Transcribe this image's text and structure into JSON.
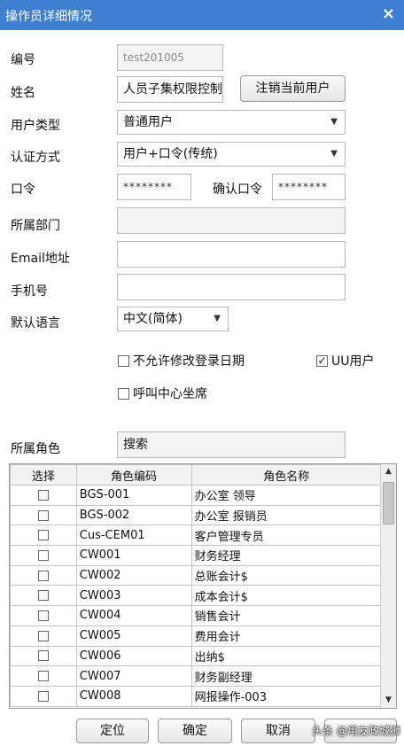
{
  "window": {
    "title": "操作员详细情况",
    "close": "×"
  },
  "form": {
    "id_label": "编号",
    "id_value": "test201005",
    "name_label": "姓名",
    "name_value": "人员子集权限控制",
    "cancel_user_button": "注销当前用户",
    "user_type_label": "用户类型",
    "user_type_value": "普通用户",
    "auth_label": "认证方式",
    "auth_value": "用户+口令(传统)",
    "password_label": "口令",
    "password_value": "********",
    "confirm_label": "确认口令",
    "confirm_value": "********",
    "dept_label": "所属部门",
    "dept_value": "",
    "email_label": "Email地址",
    "email_value": "",
    "phone_label": "手机号",
    "phone_value": "",
    "lang_label": "默认语言",
    "lang_value": "中文(简体)",
    "no_change_login_date": {
      "label": "不允许修改登录日期",
      "checked": false
    },
    "uu_user": {
      "label": "UU用户",
      "checked": true
    },
    "call_center_agent": {
      "label": "呼叫中心坐席",
      "checked": false
    },
    "role_label": "所属角色",
    "role_search_value": "搜索"
  },
  "grid": {
    "headers": [
      "选择",
      "角色编码",
      "角色名称"
    ],
    "rows": [
      {
        "code": "BGS-001",
        "name": "办公室 领导"
      },
      {
        "code": "BGS-002",
        "name": "办公室 报销员"
      },
      {
        "code": "Cus-CEM01",
        "name": "客户管理专员"
      },
      {
        "code": "CW001",
        "name": "财务经理"
      },
      {
        "code": "CW002",
        "name": "总账会计$"
      },
      {
        "code": "CW003",
        "name": "成本会计$"
      },
      {
        "code": "CW004",
        "name": "销售会计"
      },
      {
        "code": "CW005",
        "name": "费用会计"
      },
      {
        "code": "CW006",
        "name": "出纳$"
      },
      {
        "code": "CW007",
        "name": "财务副经理"
      },
      {
        "code": "CW008",
        "name": "网报操作-003"
      }
    ]
  },
  "buttons": {
    "locate": "定位",
    "confirm": "确定",
    "cancel": "取消"
  },
  "watermark": "头条 @用友政城狮"
}
